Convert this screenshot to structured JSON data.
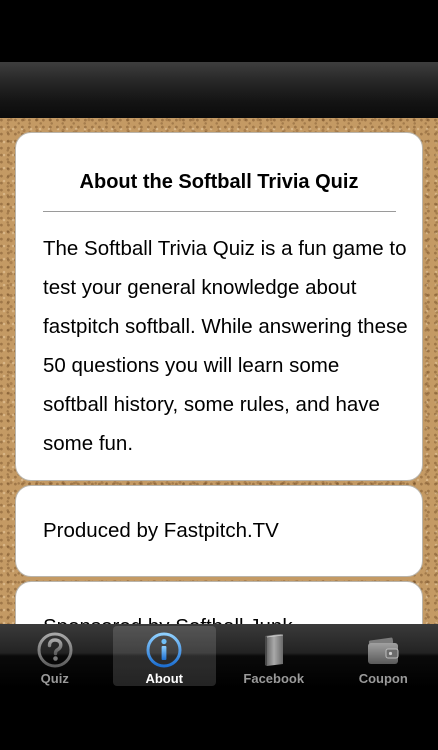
{
  "about": {
    "title": "About the Softball Trivia Quiz",
    "body": "The Softball Trivia Quiz is a fun game to test your general knowledge about fastpitch softball. While answering these 50 questions you will learn some softball history, some rules, and have some fun."
  },
  "producer": {
    "text": "Produced by Fastpitch.TV"
  },
  "sponsor": {
    "text": "Sponsored by Softball Junk"
  },
  "tabs": [
    {
      "label": "Quiz",
      "icon": "question-icon"
    },
    {
      "label": "About",
      "icon": "info-icon",
      "active": true
    },
    {
      "label": "Facebook",
      "icon": "book-icon"
    },
    {
      "label": "Coupon",
      "icon": "wallet-icon"
    }
  ],
  "colors": {
    "active_tab_icon": "#3d9be9",
    "inactive_tab_icon": "#8a8a8a"
  }
}
